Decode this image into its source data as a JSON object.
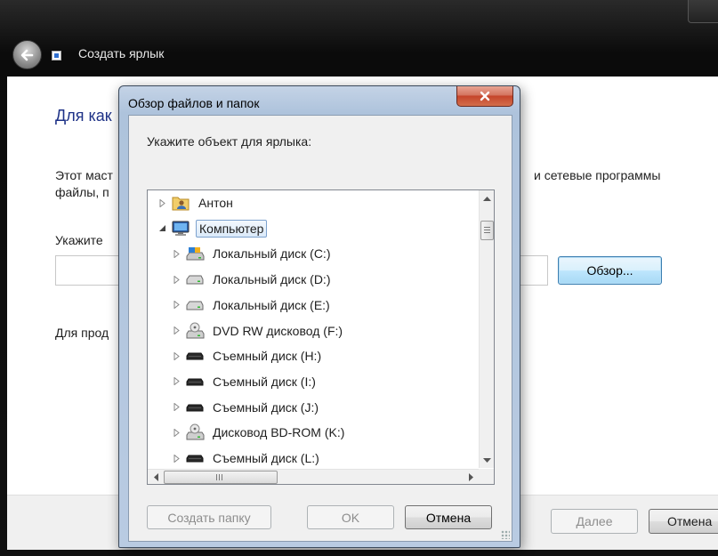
{
  "wizard": {
    "title": "Создать ярлык",
    "heading": "Для как",
    "description_left": "Этот маст",
    "description_right": "и сетевые программы",
    "description_line2": "файлы, п",
    "location_label": "Укажите",
    "location_value": "",
    "browse_label": "Обзор...",
    "continue_text": "Для прод",
    "next_label": "Далее",
    "cancel_label": "Отмена"
  },
  "dialog": {
    "title": "Обзор файлов и папок",
    "prompt": "Укажите объект для ярлыка:",
    "tree": [
      {
        "label": "Антон",
        "icon": "user-folder-icon",
        "level": 0,
        "expander": "collapsed",
        "selected": false
      },
      {
        "label": "Компьютер",
        "icon": "computer-icon",
        "level": 0,
        "expander": "expanded",
        "selected": true
      },
      {
        "label": "Локальный диск (C:)",
        "icon": "system-drive-icon",
        "level": 1,
        "expander": "collapsed",
        "selected": false
      },
      {
        "label": "Локальный диск (D:)",
        "icon": "hard-drive-icon",
        "level": 1,
        "expander": "collapsed",
        "selected": false
      },
      {
        "label": "Локальный диск (E:)",
        "icon": "hard-drive-icon",
        "level": 1,
        "expander": "collapsed",
        "selected": false
      },
      {
        "label": "DVD RW дисковод (F:)",
        "icon": "optical-drive-icon",
        "level": 1,
        "expander": "collapsed",
        "selected": false
      },
      {
        "label": "Съемный диск (H:)",
        "icon": "removable-drive-icon",
        "level": 1,
        "expander": "collapsed",
        "selected": false
      },
      {
        "label": "Съемный диск (I:)",
        "icon": "removable-drive-icon",
        "level": 1,
        "expander": "collapsed",
        "selected": false
      },
      {
        "label": "Съемный диск (J:)",
        "icon": "removable-drive-icon",
        "level": 1,
        "expander": "collapsed",
        "selected": false
      },
      {
        "label": "Дисковод BD-ROM (K:)",
        "icon": "optical-drive-icon",
        "level": 1,
        "expander": "collapsed",
        "selected": false
      },
      {
        "label": "Съемный диск (L:)",
        "icon": "removable-drive-icon",
        "level": 1,
        "expander": "collapsed",
        "selected": false
      }
    ],
    "new_folder_label": "Создать папку",
    "ok_label": "OK",
    "cancel_label": "Отмена"
  },
  "colors": {
    "heading": "#1e3287",
    "selection_border": "#7da2ce",
    "close_button": "#c5442b"
  }
}
